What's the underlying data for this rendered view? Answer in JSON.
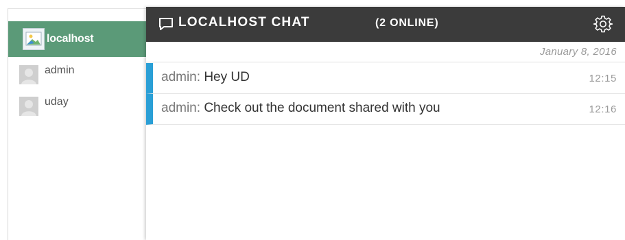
{
  "sidebar": {
    "room": {
      "label": "localhost",
      "icon": "broken-image-icon"
    },
    "users": [
      {
        "name": "admin",
        "icon": "avatar-placeholder-icon"
      },
      {
        "name": "uday",
        "icon": "avatar-placeholder-icon"
      }
    ]
  },
  "chat": {
    "title": "LOCALHOST CHAT",
    "online": "(2 ONLINE)",
    "header_icon": "chat-bubble-icon",
    "settings_icon": "gear-icon",
    "date": "January 8, 2016",
    "messages": [
      {
        "author": "admin:",
        "text": "Hey UD",
        "time": "12:15"
      },
      {
        "author": "admin:",
        "text": "Check out the document shared with you",
        "time": "12:16"
      }
    ]
  },
  "colors": {
    "sidebar_active": "#5b9a78",
    "header_bg": "#3b3b3b",
    "message_accent": "#2a9fd6"
  }
}
